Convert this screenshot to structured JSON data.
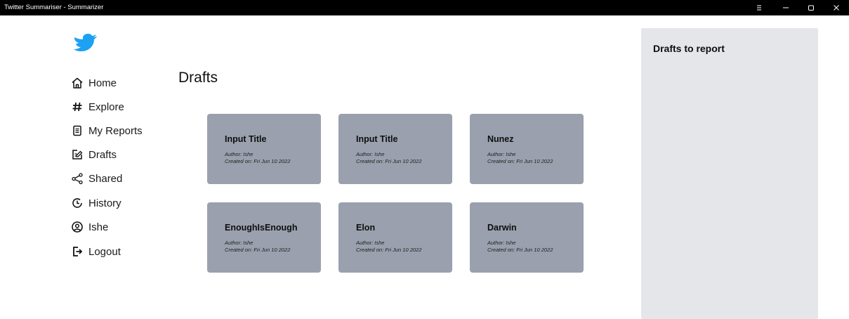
{
  "window": {
    "title": "Twitter Summariser - Summarizer",
    "controls": [
      "menu-icon",
      "minimize-icon",
      "maximize-icon",
      "close-icon"
    ]
  },
  "sidebar": {
    "logo": "twitter-bird-icon",
    "items": [
      {
        "label": "Home",
        "icon": "home-icon"
      },
      {
        "label": "Explore",
        "icon": "hashtag-icon"
      },
      {
        "label": "My Reports",
        "icon": "document-icon"
      },
      {
        "label": "Drafts",
        "icon": "draft-edit-icon"
      },
      {
        "label": "Shared",
        "icon": "share-icon"
      },
      {
        "label": "History",
        "icon": "history-icon"
      },
      {
        "label": "Ishe",
        "icon": "user-icon"
      },
      {
        "label": "Logout",
        "icon": "logout-icon"
      }
    ]
  },
  "main": {
    "title": "Drafts",
    "cards": [
      {
        "title": "Input Title",
        "author": "Author: Ishe",
        "created": "Created on: Fri Jun 10 2022"
      },
      {
        "title": "Input Title",
        "author": "Author: Ishe",
        "created": "Created on: Fri Jun 10 2022"
      },
      {
        "title": "Nunez",
        "author": "Author: Ishe",
        "created": "Created on: Fri Jun 10 2022"
      },
      {
        "title": "EnoughIsEnough",
        "author": "Author: Ishe",
        "created": "Created on: Fri Jun 10 2022"
      },
      {
        "title": "Elon",
        "author": "Author: Ishe",
        "created": "Created on: Fri Jun 10 2022"
      },
      {
        "title": "Darwin",
        "author": "Author: Ishe",
        "created": "Created on: Fri Jun 10 2022"
      }
    ]
  },
  "right_panel": {
    "title": "Drafts to report"
  },
  "colors": {
    "titlebar_bg": "#000000",
    "card_bg": "#9aa0ad",
    "panel_bg": "#e5e6ea",
    "logo_blue": "#1da1f2"
  }
}
